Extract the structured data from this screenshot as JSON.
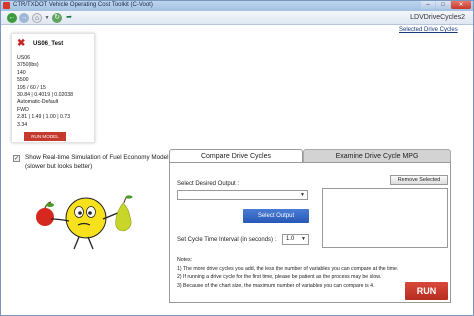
{
  "window": {
    "title": "CTR/TXDOT Vehicle Operating Cost Toolkit (C-Voot)",
    "app_name": "LDVDriveCycles2",
    "controls": {
      "minimize": "–",
      "maximize": "□",
      "close": "✕"
    }
  },
  "toolbar": {
    "back_icon": "arrow-left-icon",
    "forward_icon": "arrow-right-icon",
    "home_icon": "home-icon",
    "refresh_icon": "refresh-icon",
    "export_icon": "export-icon"
  },
  "selected_cycles_link": "Selected Drive Cycles",
  "card": {
    "name": "US06_Test",
    "lines": [
      "US06",
      "3750(lbs)",
      "140",
      "5500",
      "195 / 60 / 15",
      "30.84 | 0.4019 | 0.02038",
      "Automatic-Default",
      "FWD",
      "2.81 | 1.49 | 1.00 | 0.73",
      "3.34"
    ],
    "run_model": "RUN MODEL"
  },
  "simulation": {
    "checked": true,
    "label": "Show Real-time Simulation of Fuel Economy Model (slower but looks better)"
  },
  "tabs": [
    {
      "label": "Compare Drive Cycles",
      "active": true
    },
    {
      "label": "Examine Drive Cycle MPG",
      "active": false
    }
  ],
  "compare": {
    "select_output_label": "Select Desired Output :",
    "output_value": "",
    "select_output_button": "Select Output",
    "time_interval_label": "Set Cycle Time Interval (in seconds) :",
    "time_interval_value": "1.0",
    "remove_selected_button": "Remove Selected",
    "notes": [
      "Notes:",
      "1) The more drive cycles you add, the less the number of variables you can compare at the time.",
      "2) If running a drive cycle for the first time, please be patient as the process may be slow.",
      "3) Because of the chart size, the maximum number of variables you can compare is 4."
    ],
    "run_button": "RUN"
  },
  "colors": {
    "accent_red": "#c43a2d",
    "accent_blue": "#2f62c2",
    "mascot_yellow": "#f7e11c"
  }
}
